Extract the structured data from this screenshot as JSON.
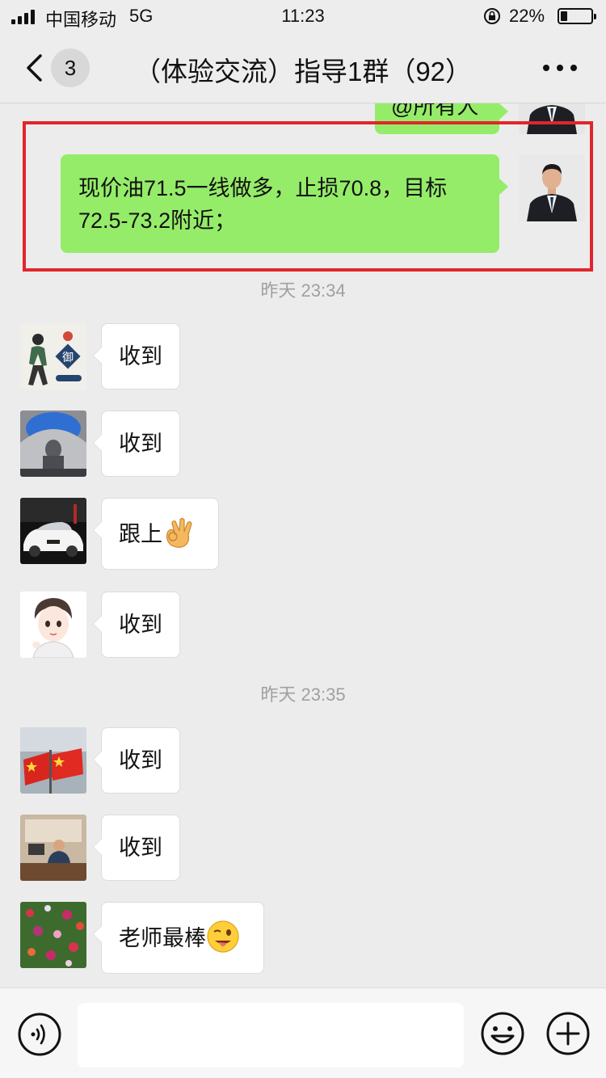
{
  "status_bar": {
    "carrier": "中国移动",
    "network": "5G",
    "time": "11:23",
    "battery_percent": "22%"
  },
  "nav": {
    "unread_count": "3",
    "title": "（体验交流）指导1群（92）"
  },
  "messages": {
    "partial_top": {
      "text": "@所有人"
    },
    "highlighted": {
      "text": "现价油71.5一线做多，止损70.8，目标72.5-73.2附近；"
    },
    "timestamp_1": "昨天 23:34",
    "reply_1": "收到",
    "reply_2": "收到",
    "reply_3": "跟上",
    "reply_4": "收到",
    "timestamp_2": "昨天 23:35",
    "reply_5": "收到",
    "reply_6": "收到",
    "reply_7": "老师最棒"
  },
  "emojis": {
    "reply_3": "ok-hand-emoji",
    "reply_7": "winking-tongue-emoji"
  },
  "input": {
    "placeholder": ""
  },
  "colors": {
    "outgoing_bubble": "#95ec69",
    "incoming_bubble": "#ffffff",
    "highlight": "#e0262d",
    "background": "#ececec"
  }
}
